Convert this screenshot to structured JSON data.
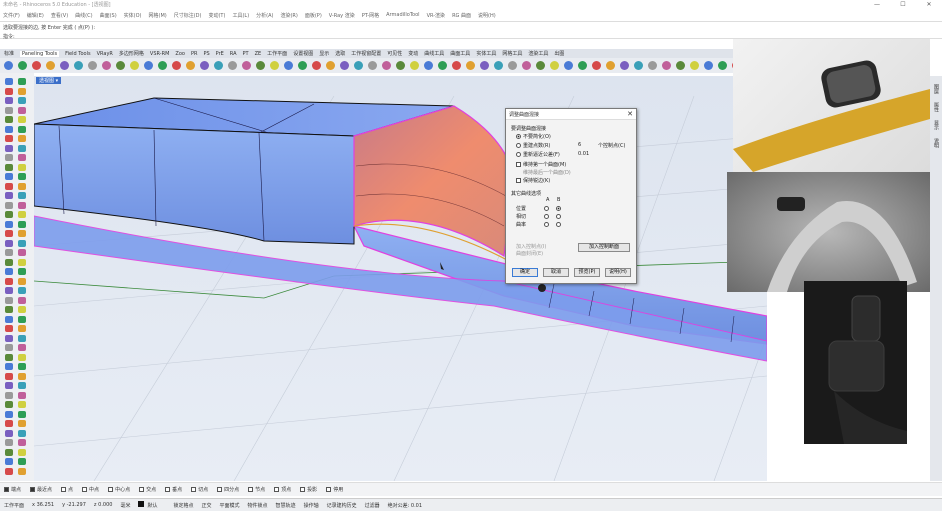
{
  "window": {
    "title": "未命名 - Rhinoceros 5.0 Education - [透视图]",
    "controls": [
      "—",
      "☐",
      "✕"
    ]
  },
  "menu": [
    "文件(F)",
    "编辑(E)",
    "查看(V)",
    "曲线(C)",
    "曲面(S)",
    "实体(O)",
    "网格(M)",
    "尺寸标注(D)",
    "变动(T)",
    "工具(L)",
    "分析(A)",
    "渲染(R)",
    "面板(P)",
    "V-Ray 渲染",
    "PT-网格",
    "ArmadilloTool",
    "VR-渲染",
    "RG 曲面",
    "说明(H)"
  ],
  "command": {
    "line1": "选取要混接的边, 按 Enter 完成 ( 点(P) ):",
    "line2": "指令:"
  },
  "tabs": [
    "标准",
    "Paneling Tools",
    "Field Tools",
    "VRayR",
    "多边形网格",
    "VSR-RM",
    "Zoo",
    "PR",
    "PS",
    "PrE",
    "RA",
    "PT",
    "ZE",
    "工作平面",
    "设置视图",
    "显示",
    "选取",
    "工作视窗配置",
    "可见性",
    "变动",
    "曲线工具",
    "曲面工具",
    "实体工具",
    "网格工具",
    "渲染工具",
    "出图"
  ],
  "active_tab": "Paneling Tools",
  "viewport": {
    "label": "透视图 ▾"
  },
  "dialog": {
    "title": "调整曲面混接",
    "close": "✕",
    "group1_title": "要调整曲面混接",
    "opts1": [
      "不要简化(O)",
      "重建点数(R)",
      "重新逼近公差(F)"
    ],
    "rebuild_count": "6",
    "rebuild_unit": "个控制点(C)",
    "tolerance": "0.01",
    "check1": "维持第一个曲面(M)",
    "check1_sub": "维持最后一个曲面(D)",
    "check2": "保持锐边(K)",
    "group2_title": "其它曲线选项",
    "col_a": "A",
    "col_b": "B",
    "rows": [
      "位置",
      "相切",
      "曲率"
    ],
    "disabled1": "加入控制点(I)",
    "disabled2": "曲面封闭(E)",
    "add_shape_btn": "加入控制断面",
    "buttons": [
      "确定",
      "取消",
      "预览(P)",
      "说明(H)"
    ]
  },
  "right_strip": [
    "图层",
    "属性",
    "显示",
    "说明"
  ],
  "snaps": [
    {
      "label": "端点",
      "on": true
    },
    {
      "label": "最近点",
      "on": true
    },
    {
      "label": "点",
      "on": false
    },
    {
      "label": "中点",
      "on": false
    },
    {
      "label": "中心点",
      "on": false
    },
    {
      "label": "交点",
      "on": false
    },
    {
      "label": "垂点",
      "on": false
    },
    {
      "label": "切点",
      "on": false
    },
    {
      "label": "四分点",
      "on": false
    },
    {
      "label": "节点",
      "on": false
    },
    {
      "label": "顶点",
      "on": false
    },
    {
      "label": "投影",
      "on": false
    },
    {
      "label": "停用",
      "on": false
    }
  ],
  "status": {
    "cplane": "工作平面",
    "x": "x 36.251",
    "y": "y -21.297",
    "z": "z 0.000",
    "unit": "毫米",
    "layer": "默认",
    "items": [
      "锁定格点",
      "正交",
      "平面模式",
      "物件锁点",
      "智慧轨迹",
      "操作轴",
      "记录建构历史",
      "过滤器",
      "绝对公差: 0.01"
    ]
  },
  "colors": {
    "accent": "#3b6fc9",
    "surface": "#7d9ded",
    "blend": "#e07a6a",
    "edge": "#e040e0"
  }
}
